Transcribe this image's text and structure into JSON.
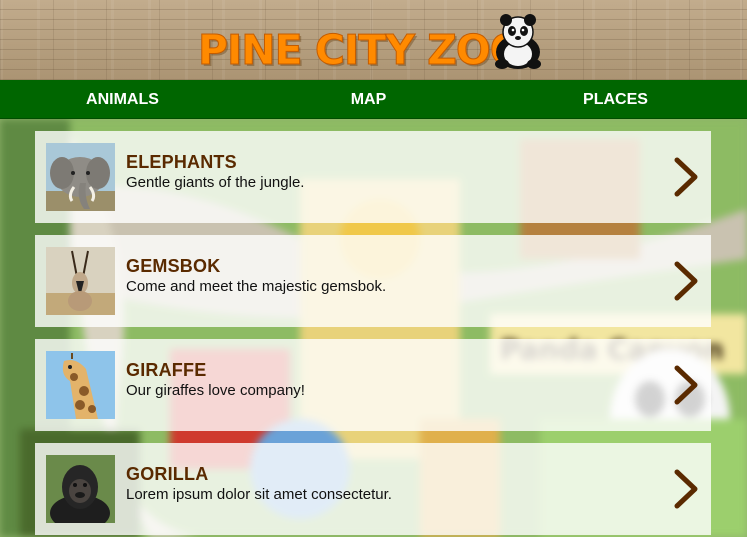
{
  "header": {
    "logo_text": "PINE CITY ZOO",
    "logo_icon": "panda-icon"
  },
  "nav": {
    "items": [
      {
        "label": "ANIMALS"
      },
      {
        "label": "MAP"
      },
      {
        "label": "PLACES"
      }
    ]
  },
  "background": {
    "sign_text": "Panda Canyon"
  },
  "animals": [
    {
      "title": "ELEPHANTS",
      "description": "Gentle giants of the jungle.",
      "thumb_icon": "elephant-photo"
    },
    {
      "title": "GEMSBOK",
      "description": "Come and meet the majestic gemsbok.",
      "thumb_icon": "gemsbok-photo"
    },
    {
      "title": "GIRAFFE",
      "description": "Our giraffes love company!",
      "thumb_icon": "giraffe-photo"
    },
    {
      "title": "GORILLA",
      "description": "Lorem ipsum dolor sit amet consectetur.",
      "thumb_icon": "gorilla-photo"
    }
  ],
  "colors": {
    "nav_bg": "#006600",
    "title_brown": "#5a2a00",
    "logo_orange": "#ff8a00",
    "chevron_brown": "#5a2a00"
  }
}
